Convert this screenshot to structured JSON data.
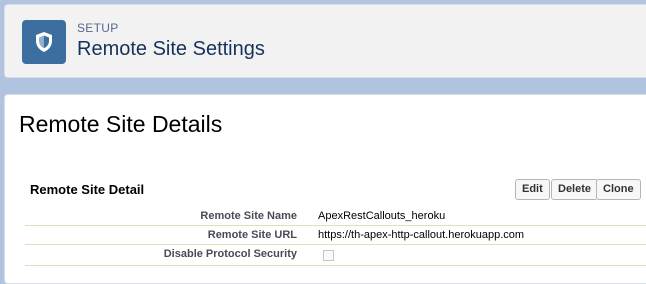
{
  "header": {
    "eyebrow": "SETUP",
    "title": "Remote Site Settings",
    "icon": "setup-shield-icon"
  },
  "page": {
    "heading": "Remote Site Details"
  },
  "detail": {
    "section_title": "Remote Site Detail",
    "buttons": {
      "edit": "Edit",
      "delete": "Delete",
      "clone": "Clone"
    },
    "rows": [
      {
        "label": "Remote Site Name",
        "value": "ApexRestCallouts_heroku"
      },
      {
        "label": "Remote Site URL",
        "value": "https://th-apex-http-callout.herokuapp.com"
      },
      {
        "label": "Disable Protocol Security",
        "value": ""
      }
    ],
    "disable_protocol_security_checked": false
  },
  "colors": {
    "background": "#b0c4df",
    "icon_bg": "#3c6ea0",
    "title": "#16325c"
  }
}
